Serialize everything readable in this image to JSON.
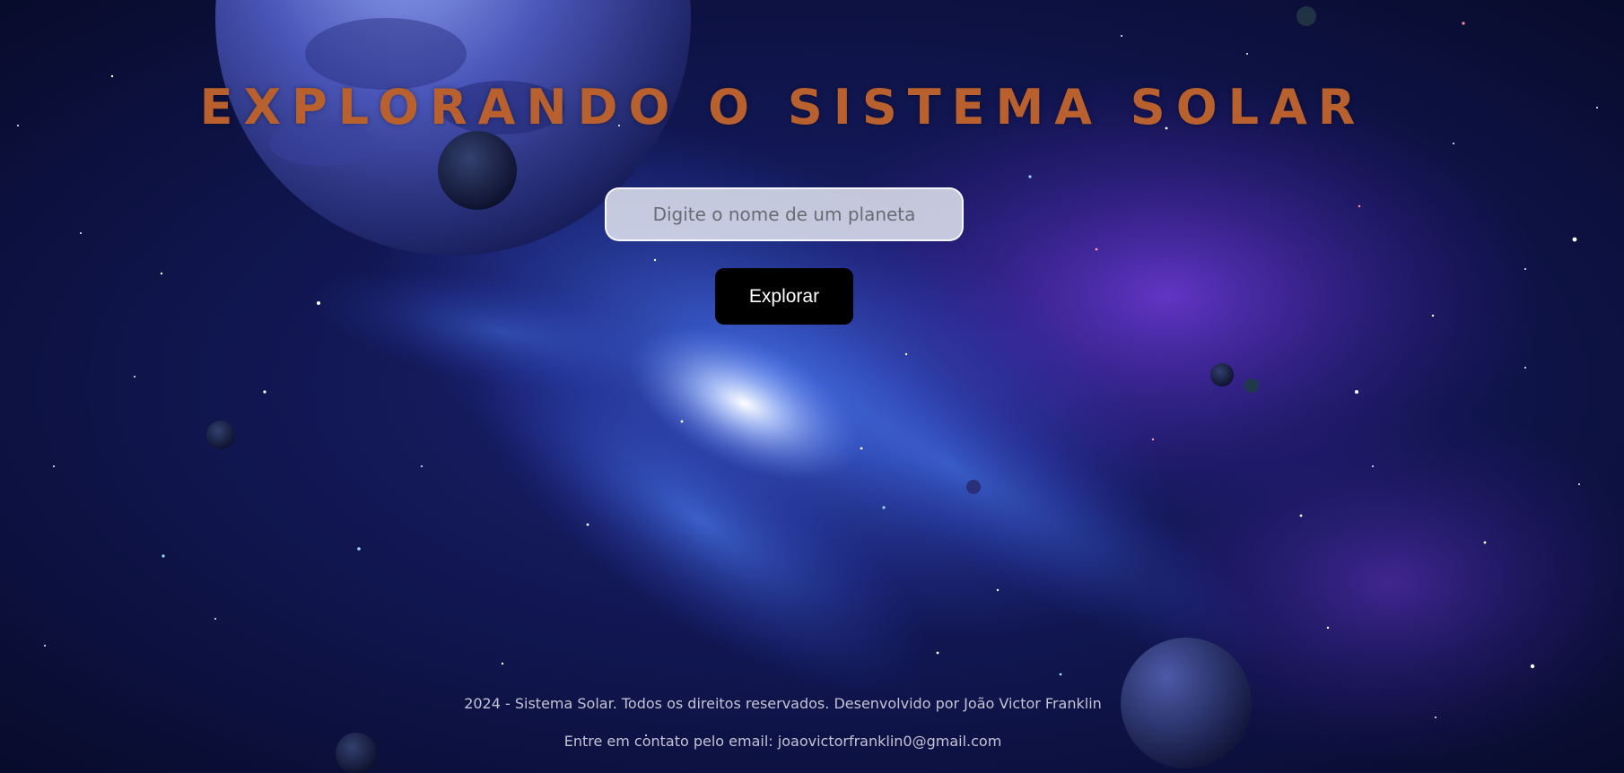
{
  "header": {
    "title": "EXPLORANDO O SISTEMA SOLAR"
  },
  "search": {
    "placeholder": "Digite o nome de um planeta",
    "value": ""
  },
  "actions": {
    "explore_label": "Explorar"
  },
  "footer": {
    "copyright": "2024 - Sistema Solar. Todos os direitos reservados. Desenvolvido por João Victor Franklin",
    "contact": "Entre em contato pelo email: joaovictorfranklin0@gmail.com"
  },
  "colors": {
    "title": "#b9602f",
    "button_bg": "#000000",
    "button_text": "#ffffff",
    "input_bg": "#e1e4f0",
    "footer_text": "#c4c4d4",
    "space_bg": "#0a0d2e",
    "nebula": "#5a56e0"
  }
}
